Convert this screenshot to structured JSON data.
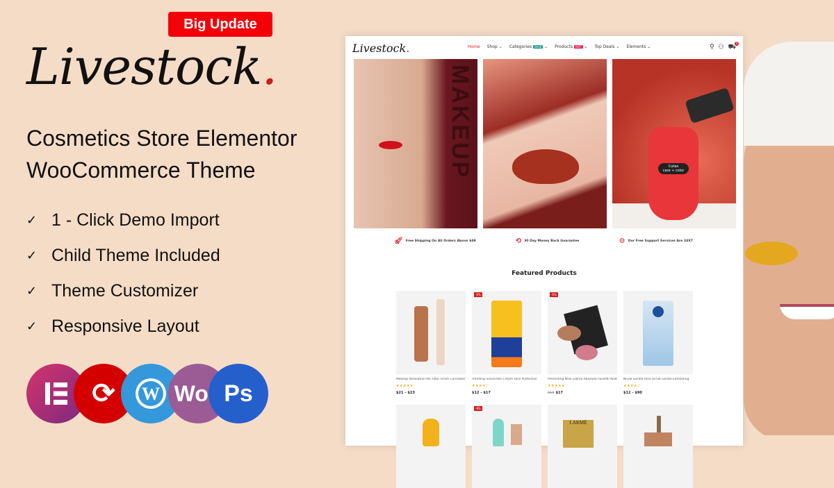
{
  "promo": {
    "badge": "Big Update",
    "logo_text": "Livestock",
    "logo_dot": ".",
    "headline_line1": "Cosmetics Store Elementor",
    "headline_line2": "WooCommerce Theme",
    "features": [
      "1 - Click Demo Import",
      "Child Theme Included",
      "Theme Customizer",
      "Responsive Layout"
    ],
    "tech_logos": [
      {
        "name": "elementor",
        "glyph": "E"
      },
      {
        "name": "update",
        "glyph": "⟳"
      },
      {
        "name": "wordpress",
        "glyph": "W"
      },
      {
        "name": "woocommerce",
        "glyph": "Woo"
      },
      {
        "name": "photoshop",
        "glyph": "Ps"
      }
    ]
  },
  "site": {
    "logo_text": "Livestock",
    "logo_dot": ".",
    "nav": [
      {
        "label": "Home",
        "active": true
      },
      {
        "label": "Shop",
        "dropdown": true
      },
      {
        "label": "Categories",
        "dropdown": true,
        "tag": "SALE",
        "tag_color": "#1e9c87"
      },
      {
        "label": "Products",
        "dropdown": true,
        "tag": "HOT",
        "tag_color": "#e8245b"
      },
      {
        "label": "Top Deals",
        "dropdown": true
      },
      {
        "label": "Elements",
        "dropdown": true
      }
    ],
    "cart_count": "0",
    "banner_text": "MAKEUP",
    "nail_label_brand": "Cutex",
    "nail_label_line": "care + color",
    "services": [
      {
        "icon": "rocket-icon",
        "text": "Free Shipping On All Orders Above $49"
      },
      {
        "icon": "money-back-icon",
        "text": "30 Day Money Back Guarantee"
      },
      {
        "icon": "support-icon",
        "text": "Our Free Support Services Are 24X7"
      }
    ],
    "featured_title": "Featured Products",
    "products": [
      {
        "name": "Makeup Revolution IRL Filter Finish Concealer",
        "rating": 5,
        "stars": "★★★★★",
        "price": "$21 – $23",
        "old_price": "",
        "sale": ""
      },
      {
        "name": "Trending Sunscreen Cream Face Protection",
        "rating": 4,
        "stars": "★★★★☆",
        "price": "$12 – $17",
        "old_price": "",
        "sale": "-6%"
      },
      {
        "name": "Presenting New Lakme Absolute Facelift Palette",
        "rating": 5,
        "stars": "★★★★★",
        "price": "$17",
        "old_price": "$18",
        "sale": "-6%"
      },
      {
        "name": "Nivea Gentle Face Scrub Gentle Exfoliating",
        "rating": 4,
        "stars": "★★★★☆",
        "price": "$12 – $90",
        "old_price": "",
        "sale": ""
      }
    ],
    "products_row2": [
      {
        "sale": ""
      },
      {
        "sale": "-8%"
      },
      {
        "sale": "",
        "brand": "LAKMÉ"
      },
      {
        "sale": ""
      }
    ]
  }
}
